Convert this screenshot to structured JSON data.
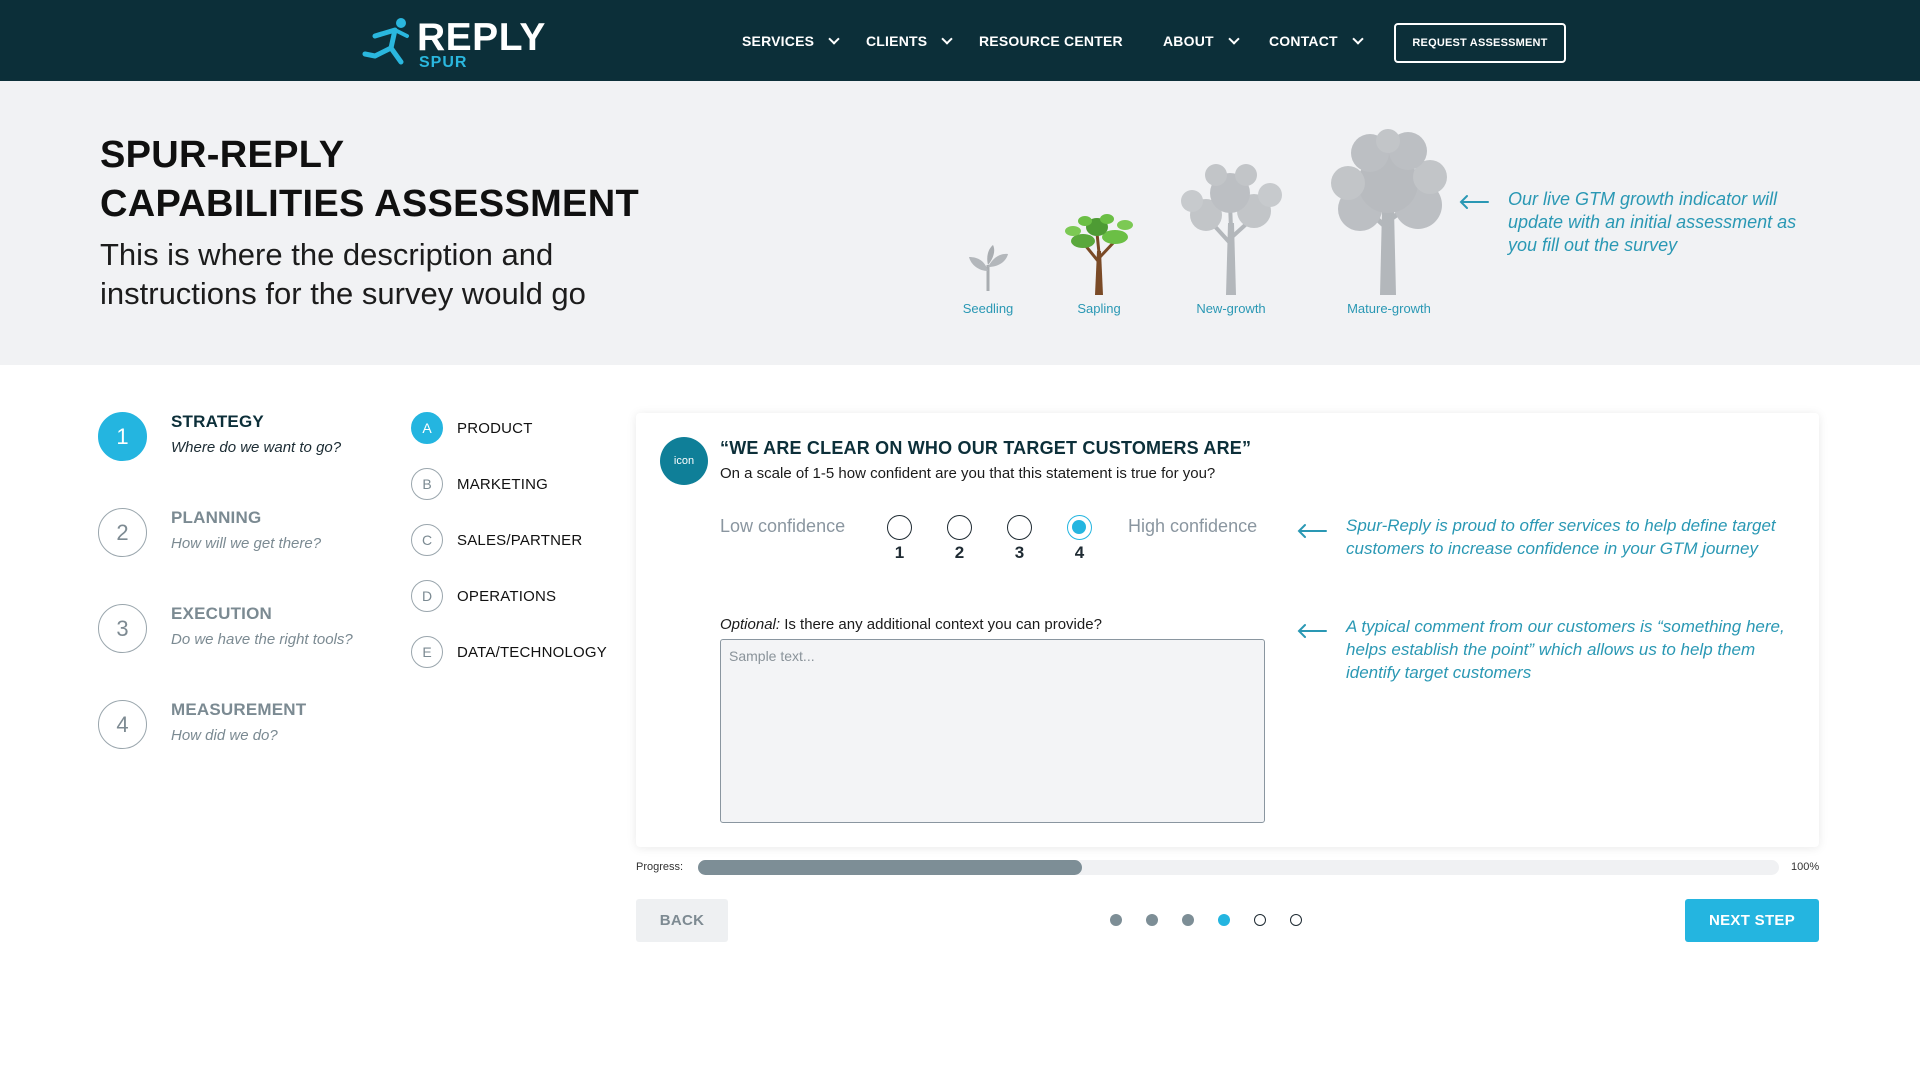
{
  "nav": {
    "logo_word": "REPLY",
    "logo_sub": "SPUR",
    "items": [
      {
        "label": "SERVICES",
        "dropdown": true
      },
      {
        "label": "CLIENTS",
        "dropdown": true
      },
      {
        "label": "RESOURCE CENTER",
        "dropdown": false
      },
      {
        "label": "ABOUT",
        "dropdown": true
      },
      {
        "label": "CONTACT",
        "dropdown": true
      }
    ],
    "cta": "REQUEST ASSESSMENT"
  },
  "hero": {
    "title_line1": "SPUR-REPLY",
    "title_line2": "CAPABILITIES ASSESSMENT",
    "description": "This is where the description and instructions for the survey would go",
    "growth_stages": [
      "Seedling",
      "Sapling",
      "New-growth",
      "Mature-growth"
    ],
    "current_stage": "Sapling",
    "note": "Our live GTM growth indicator will update with an initial assessment as you fill out the survey"
  },
  "steps": [
    {
      "num": "1",
      "title": "STRATEGY",
      "subtitle": "Where do we want to go?",
      "active": true
    },
    {
      "num": "2",
      "title": "PLANNING",
      "subtitle": "How will we get there?",
      "active": false
    },
    {
      "num": "3",
      "title": "EXECUTION",
      "subtitle": "Do we have the right tools?",
      "active": false
    },
    {
      "num": "4",
      "title": "MEASUREMENT",
      "subtitle": "How did we do?",
      "active": false
    }
  ],
  "categories": [
    {
      "letter": "A",
      "label": "PRODUCT",
      "active": true
    },
    {
      "letter": "B",
      "label": "MARKETING",
      "active": false
    },
    {
      "letter": "C",
      "label": "SALES/PARTNER",
      "active": false
    },
    {
      "letter": "D",
      "label": "OPERATIONS",
      "active": false
    },
    {
      "letter": "E",
      "label": "DATA/TECHNOLOGY",
      "active": false
    }
  ],
  "question": {
    "icon_text": "icon",
    "title": "“WE ARE CLEAR ON WHO OUR TARGET CUSTOMERS ARE”",
    "subtitle": "On a scale of 1-5 how confident are you that this statement is true for you?",
    "low_label": "Low confidence",
    "high_label": "High confidence",
    "options": [
      "1",
      "2",
      "3",
      "4"
    ],
    "selected": "4",
    "optional_prefix": "Optional:",
    "optional_text": " Is there any additional context you can provide?",
    "textarea_placeholder": "Sample text...",
    "note_1": "Spur-Reply is proud to offer services to help define target customers to increase confidence in your GTM journey",
    "note_2": "A typical comment from our customers is “something here, helps establish the point” which allows us to help them identify target customers"
  },
  "progress": {
    "label": "Progress:",
    "max_label": "100%",
    "fraction": 0.355
  },
  "footer": {
    "back": "BACK",
    "next": "NEXT STEP",
    "dots": [
      "done",
      "done",
      "done",
      "current",
      "empty",
      "empty"
    ]
  },
  "colors": {
    "nav_bg": "#0c2f39",
    "accent": "#24b5e0",
    "note_text": "#2a98b4",
    "hero_bg": "#f1f2f4"
  }
}
